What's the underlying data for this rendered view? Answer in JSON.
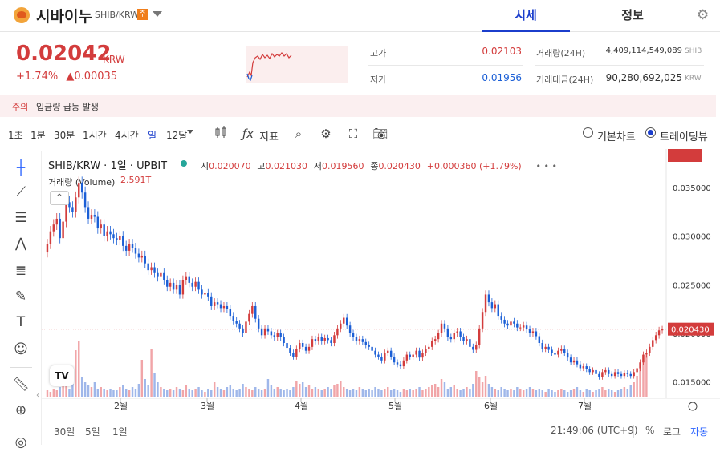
{
  "header": {
    "coin_name": "시바이누",
    "pair": "SHIB/KRW",
    "badge": "주",
    "tabs": [
      {
        "label": "시세"
      },
      {
        "label": "정보"
      }
    ]
  },
  "price": {
    "value": "0.02042",
    "unit": "KRW",
    "change_pct": "+1.74%",
    "change_abs": "▲0.00035"
  },
  "stats": {
    "high_label": "고가",
    "high_value": "0.02103",
    "low_label": "저가",
    "low_value": "0.01956",
    "volume_label": "거래량(24H)",
    "volume_value": "4,409,114,549,089",
    "volume_unit": "SHIB",
    "amount_label": "거래대금(24H)",
    "amount_value": "90,280,692,025",
    "amount_unit": "KRW"
  },
  "warning": {
    "label": "주의",
    "text": "입금량 급등 발생"
  },
  "toolbar": {
    "timeframes": [
      "1초",
      "1분",
      "30분",
      "1시간",
      "4시간",
      "일",
      "12달"
    ],
    "indicator_label": "지표",
    "basic_chart": "기본차트",
    "trading_view": "트레이딩뷰"
  },
  "chart_head": {
    "symbol": "SHIB/KRW · 1일 · UPBIT",
    "open_label": "시",
    "open": "0.020070",
    "high_label": "고",
    "high": "0.021030",
    "low_label": "저",
    "low": "0.019560",
    "close_label": "종",
    "close": "0.020430",
    "change": "+0.000360 (+1.79%)",
    "volume_label": "거래량 (Volume)",
    "volume_value": "2.591T"
  },
  "bottom": {
    "ranges": [
      "30일",
      "5일",
      "1일"
    ],
    "time": "21:49:06 (UTC+9)",
    "pct": "%",
    "log": "로그",
    "auto": "자동"
  },
  "chart_data": {
    "type": "candlestick",
    "x_ticks": [
      "2월",
      "3월",
      "4월",
      "5월",
      "6월",
      "7월"
    ],
    "y_ticks": [
      "0.035000",
      "0.030000",
      "0.025000",
      "0.020000",
      "0.015000"
    ],
    "last_price_label": "0.020430",
    "last_volume_label": "2.591T",
    "ylim": [
      0.0138,
      0.0365
    ],
    "up_color": "#d33c3c",
    "down_color": "#1b5fd6",
    "closes": [
      0.0292,
      0.0305,
      0.0312,
      0.0318,
      0.0298,
      0.0315,
      0.0335,
      0.033,
      0.0325,
      0.034,
      0.0355,
      0.0345,
      0.033,
      0.0318,
      0.0322,
      0.032,
      0.0308,
      0.0312,
      0.03,
      0.0305,
      0.0302,
      0.0298,
      0.0296,
      0.03,
      0.029,
      0.0285,
      0.0292,
      0.0288,
      0.0282,
      0.0278,
      0.028,
      0.0272,
      0.0265,
      0.0268,
      0.0262,
      0.0258,
      0.0262,
      0.0255,
      0.0248,
      0.0252,
      0.0245,
      0.025,
      0.024,
      0.0255,
      0.0258,
      0.0252,
      0.0248,
      0.0253,
      0.0245,
      0.024,
      0.0242,
      0.0238,
      0.0228,
      0.0232,
      0.023,
      0.0226,
      0.0228,
      0.0225,
      0.0218,
      0.0213,
      0.021,
      0.0205,
      0.02,
      0.0212,
      0.022,
      0.0228,
      0.0215,
      0.0205,
      0.0198,
      0.0205,
      0.0202,
      0.0198,
      0.0196,
      0.02,
      0.0196,
      0.019,
      0.0185,
      0.018,
      0.0176,
      0.0184,
      0.019,
      0.0186,
      0.0182,
      0.0186,
      0.0194,
      0.0192,
      0.0196,
      0.0192,
      0.0195,
      0.0193,
      0.019,
      0.0198,
      0.0205,
      0.021,
      0.0216,
      0.0208,
      0.02,
      0.0196,
      0.0192,
      0.0194,
      0.0191,
      0.0188,
      0.0186,
      0.0182,
      0.0178,
      0.0176,
      0.0172,
      0.018,
      0.0182,
      0.0176,
      0.017,
      0.0168,
      0.0166,
      0.0172,
      0.0178,
      0.0176,
      0.0178,
      0.0182,
      0.0175,
      0.018,
      0.0184,
      0.0186,
      0.0192,
      0.0194,
      0.02,
      0.021,
      0.0205,
      0.0196,
      0.0194,
      0.02,
      0.0202,
      0.0196,
      0.0192,
      0.0194,
      0.0186,
      0.0183,
      0.0188,
      0.0205,
      0.0222,
      0.024,
      0.0232,
      0.0226,
      0.023,
      0.0218,
      0.0214,
      0.021,
      0.0208,
      0.0212,
      0.021,
      0.0206,
      0.0206,
      0.0208,
      0.0204,
      0.02,
      0.0202,
      0.0197,
      0.019,
      0.0184,
      0.0186,
      0.0183,
      0.018,
      0.0178,
      0.0182,
      0.0184,
      0.018,
      0.0175,
      0.017,
      0.0172,
      0.0168,
      0.0164,
      0.0166,
      0.0163,
      0.016,
      0.0162,
      0.0158,
      0.0155,
      0.016,
      0.0162,
      0.0158,
      0.0156,
      0.016,
      0.0158,
      0.0156,
      0.0159,
      0.0158,
      0.0156,
      0.016,
      0.0164,
      0.017,
      0.0178,
      0.018,
      0.0186,
      0.0193,
      0.0198,
      0.0203,
      0.0204
    ],
    "volumes": [
      0.4,
      0.3,
      0.5,
      0.4,
      0.6,
      0.9,
      0.7,
      0.5,
      0.8,
      2.9,
      3.5,
      1.2,
      0.9,
      0.7,
      0.6,
      0.9,
      0.5,
      0.6,
      0.5,
      0.4,
      0.5,
      0.4,
      0.4,
      0.6,
      0.7,
      0.5,
      0.4,
      0.6,
      0.5,
      0.8,
      2.3,
      1.1,
      0.7,
      3.0,
      1.5,
      0.9,
      0.6,
      0.5,
      0.4,
      0.5,
      0.4,
      0.6,
      0.5,
      0.4,
      0.7,
      0.5,
      0.4,
      0.5,
      0.6,
      0.4,
      0.3,
      0.5,
      0.4,
      0.9,
      0.6,
      0.5,
      0.4,
      0.6,
      0.7,
      0.5,
      0.4,
      0.5,
      0.8,
      0.6,
      0.5,
      0.4,
      0.6,
      0.5,
      0.4,
      0.5,
      1.1,
      0.7,
      0.5,
      0.6,
      0.5,
      0.4,
      0.5,
      0.4,
      0.6,
      1.0,
      0.8,
      0.9,
      0.6,
      0.7,
      0.5,
      0.6,
      0.5,
      0.4,
      0.5,
      0.6,
      0.5,
      0.7,
      0.8,
      1.0,
      0.6,
      0.5,
      0.4,
      0.5,
      0.4,
      0.6,
      0.5,
      0.4,
      0.5,
      0.4,
      0.6,
      0.5,
      0.4,
      0.5,
      0.6,
      0.4,
      0.5,
      0.4,
      0.3,
      0.5,
      0.4,
      0.5,
      0.4,
      0.5,
      0.6,
      0.4,
      0.5,
      0.6,
      0.7,
      0.8,
      0.6,
      1.1,
      0.9,
      0.5,
      0.6,
      0.7,
      0.5,
      0.4,
      0.5,
      0.6,
      0.5,
      0.8,
      1.6,
      1.2,
      0.9,
      1.3,
      0.8,
      0.6,
      0.5,
      0.4,
      0.6,
      0.5,
      0.4,
      0.5,
      0.4,
      0.6,
      0.5,
      0.4,
      0.5,
      0.6,
      0.5,
      0.4,
      0.5,
      0.4,
      0.3,
      0.5,
      0.4,
      0.3,
      0.4,
      0.5,
      0.4,
      0.3,
      0.4,
      0.5,
      0.6,
      0.4,
      0.3,
      0.5,
      0.4,
      0.3,
      0.4,
      0.5,
      0.6,
      0.4,
      0.5,
      0.4,
      0.3,
      0.4,
      0.5,
      0.6,
      0.5,
      0.7,
      0.9,
      1.3,
      1.8,
      2.6,
      2.591
    ]
  }
}
